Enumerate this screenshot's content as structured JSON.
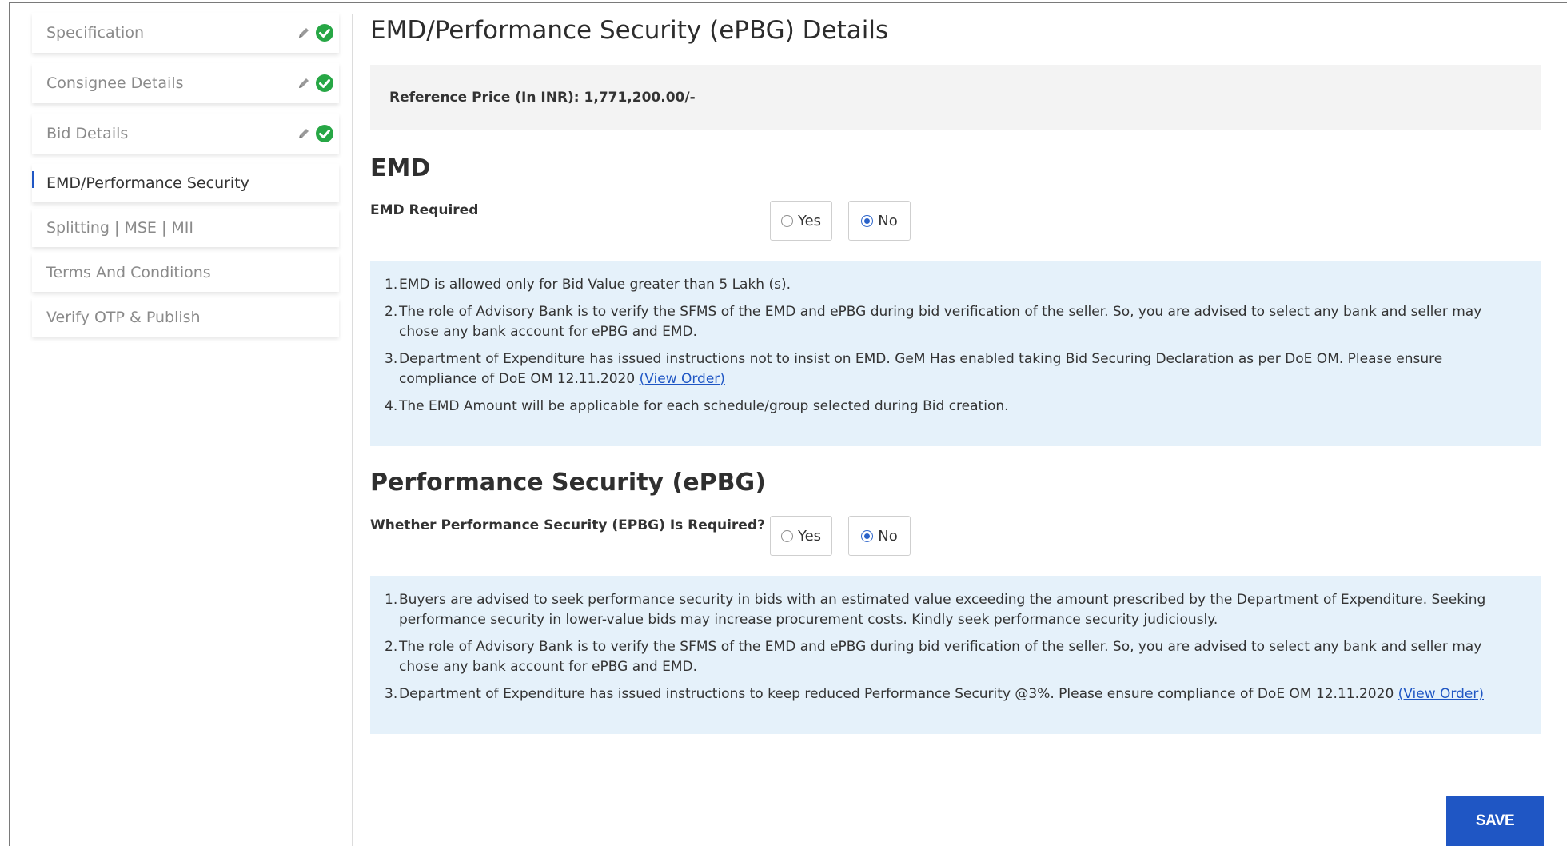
{
  "sidebar": {
    "steps": [
      {
        "label": "Specification",
        "completed": true
      },
      {
        "label": "Consignee Details",
        "completed": true
      },
      {
        "label": "Bid Details",
        "completed": true
      },
      {
        "label": "EMD/Performance Security",
        "active": true
      },
      {
        "label": "Splitting | MSE | MII"
      },
      {
        "label": "Terms And Conditions"
      },
      {
        "label": "Verify OTP & Publish"
      }
    ]
  },
  "main": {
    "title": "EMD/Performance Security (ePBG) Details",
    "reference_price": "Reference Price (In INR): 1,771,200.00/-",
    "emd": {
      "heading": "EMD",
      "field_label": "EMD Required",
      "options": {
        "yes": "Yes",
        "no": "No"
      },
      "selected": "No",
      "notes": [
        {
          "num": "1.",
          "text": "EMD is allowed only for Bid Value greater than 5 Lakh (s)."
        },
        {
          "num": "2.",
          "text": "The role of Advisory Bank is to verify the SFMS of the EMD and ePBG during bid verification of the seller. So, you are advised to select any bank and seller may chose any bank account for ePBG and EMD."
        },
        {
          "num": "3.",
          "text": "Department of Expenditure has issued instructions not to insist on EMD. GeM Has enabled taking Bid Securing Declaration as per DoE OM. Please ensure compliance of DoE OM 12.11.2020",
          "link": "(View Order)"
        },
        {
          "num": "4.",
          "text": "The EMD Amount will be applicable for each schedule/group selected during Bid creation."
        }
      ]
    },
    "epbg": {
      "heading": "Performance Security (ePBG)",
      "field_label": "Whether Performance Security (EPBG) Is Required?",
      "options": {
        "yes": "Yes",
        "no": "No"
      },
      "selected": "No",
      "notes": [
        {
          "num": "1.",
          "text": "Buyers are advised to seek performance security in bids with an estimated value exceeding the amount prescribed by the Department of Expenditure. Seeking performance security in lower-value bids may increase procurement costs. Kindly seek performance security judiciously."
        },
        {
          "num": "2.",
          "text": "The role of Advisory Bank is to verify the SFMS of the EMD and ePBG during bid verification of the seller. So, you are advised to select any bank and seller may chose any bank account for ePBG and EMD."
        },
        {
          "num": "3.",
          "text": "Department of Expenditure has issued instructions to keep reduced Performance Security @3%. Please ensure compliance of DoE OM 12.11.2020",
          "link": "(View Order)"
        }
      ]
    },
    "save_label": "SAVE"
  },
  "colors": {
    "primary": "#1f56c4",
    "check_green": "#27a745",
    "info_bg": "#e5f1fa",
    "ref_bg": "#f3f3f3"
  },
  "icons": {
    "completed_step": [
      "pencil-icon",
      "check-circle-icon"
    ],
    "radio": "radio-circle"
  }
}
